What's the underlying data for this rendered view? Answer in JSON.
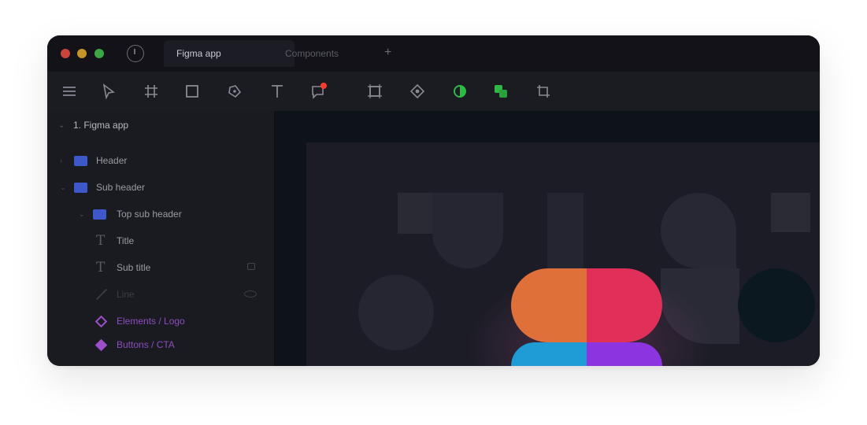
{
  "titlebar": {
    "tabs": [
      {
        "label": "Figma app",
        "active": true
      },
      {
        "label": "Components",
        "active": false
      }
    ],
    "add_tab_label": "+"
  },
  "toolbar": {
    "tools": [
      "menu-icon",
      "move-icon",
      "frame-icon",
      "rectangle-icon",
      "pen-icon",
      "text-icon",
      "comment-icon",
      "component-frame-icon",
      "plugin-icon",
      "contrast-icon",
      "boolean-icon",
      "crop-icon"
    ]
  },
  "sidebar": {
    "page": "1. Figma app",
    "layers": [
      {
        "label": "Header",
        "type": "frame"
      },
      {
        "label": "Sub header",
        "type": "frame"
      },
      {
        "label": "Top sub header",
        "type": "frame"
      },
      {
        "label": "Title",
        "type": "text"
      },
      {
        "label": "Sub title",
        "type": "text"
      },
      {
        "label": "Line",
        "type": "line"
      },
      {
        "label": "Elements / Logo",
        "type": "component"
      },
      {
        "label": "Buttons / CTA",
        "type": "instance"
      }
    ]
  },
  "colors": {
    "accent_blue": "#3d59c9",
    "component_purple": "#9c4fc9",
    "logo_orange": "#e0703a",
    "logo_red": "#e0305a",
    "logo_blue": "#1f9bd6",
    "logo_purple": "#8b34e0",
    "notification_red": "#ff3b30"
  }
}
